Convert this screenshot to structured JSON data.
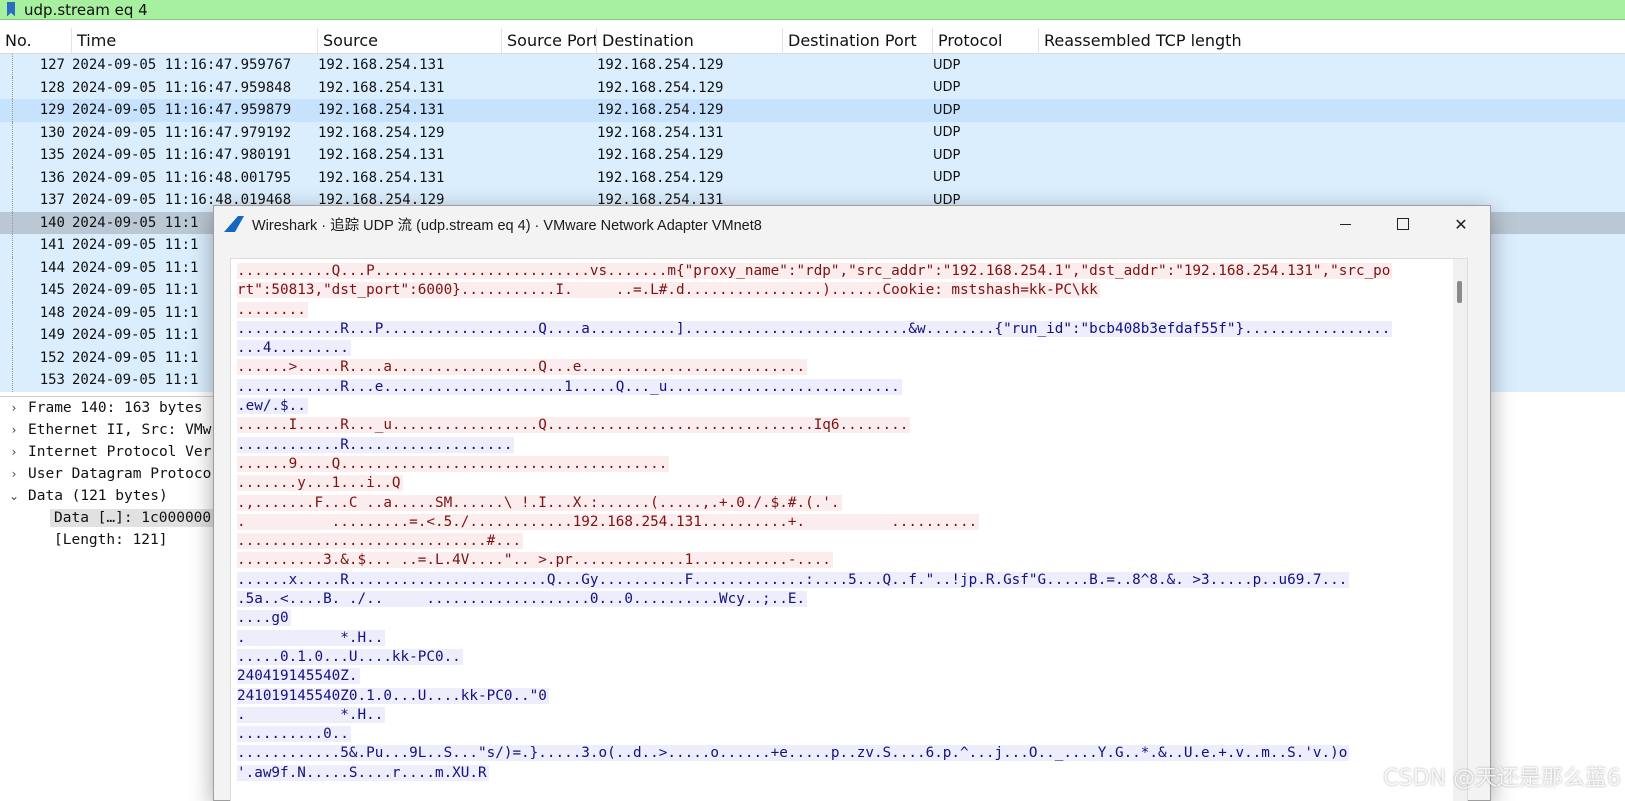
{
  "filter": {
    "text": "udp.stream eq 4"
  },
  "packet_list": {
    "columns": [
      "No.",
      "Time",
      "Source",
      "Source Port",
      "Destination",
      "Destination Port",
      "Protocol",
      "Reassembled TCP length"
    ],
    "rows": [
      {
        "no": "127",
        "time": "2024-09-05 11:16:47.959767",
        "src": "192.168.254.131",
        "sport": "",
        "dst": "192.168.254.129",
        "dport": "",
        "proto": "UDP",
        "len": ""
      },
      {
        "no": "128",
        "time": "2024-09-05 11:16:47.959848",
        "src": "192.168.254.131",
        "sport": "",
        "dst": "192.168.254.129",
        "dport": "",
        "proto": "UDP",
        "len": ""
      },
      {
        "no": "129",
        "time": "2024-09-05 11:16:47.959879",
        "src": "192.168.254.131",
        "sport": "",
        "dst": "192.168.254.129",
        "dport": "",
        "proto": "UDP",
        "len": ""
      },
      {
        "no": "130",
        "time": "2024-09-05 11:16:47.979192",
        "src": "192.168.254.129",
        "sport": "",
        "dst": "192.168.254.131",
        "dport": "",
        "proto": "UDP",
        "len": ""
      },
      {
        "no": "135",
        "time": "2024-09-05 11:16:47.980191",
        "src": "192.168.254.131",
        "sport": "",
        "dst": "192.168.254.129",
        "dport": "",
        "proto": "UDP",
        "len": ""
      },
      {
        "no": "136",
        "time": "2024-09-05 11:16:48.001795",
        "src": "192.168.254.131",
        "sport": "",
        "dst": "192.168.254.129",
        "dport": "",
        "proto": "UDP",
        "len": ""
      },
      {
        "no": "137",
        "time": "2024-09-05 11:16:48.019468",
        "src": "192.168.254.129",
        "sport": "",
        "dst": "192.168.254.131",
        "dport": "",
        "proto": "UDP",
        "len": ""
      },
      {
        "no": "140",
        "time": "2024-09-05 11:1",
        "src": "",
        "sport": "",
        "dst": "",
        "dport": "",
        "proto": "",
        "len": ""
      },
      {
        "no": "141",
        "time": "2024-09-05 11:1",
        "src": "",
        "sport": "",
        "dst": "",
        "dport": "",
        "proto": "",
        "len": ""
      },
      {
        "no": "144",
        "time": "2024-09-05 11:1",
        "src": "",
        "sport": "",
        "dst": "",
        "dport": "",
        "proto": "",
        "len": ""
      },
      {
        "no": "145",
        "time": "2024-09-05 11:1",
        "src": "",
        "sport": "",
        "dst": "",
        "dport": "",
        "proto": "",
        "len": ""
      },
      {
        "no": "148",
        "time": "2024-09-05 11:1",
        "src": "",
        "sport": "",
        "dst": "",
        "dport": "",
        "proto": "",
        "len": ""
      },
      {
        "no": "149",
        "time": "2024-09-05 11:1",
        "src": "",
        "sport": "",
        "dst": "",
        "dport": "",
        "proto": "",
        "len": ""
      },
      {
        "no": "152",
        "time": "2024-09-05 11:1",
        "src": "",
        "sport": "",
        "dst": "",
        "dport": "",
        "proto": "",
        "len": ""
      },
      {
        "no": "153",
        "time": "2024-09-05 11:1",
        "src": "",
        "sport": "",
        "dst": "",
        "dport": "",
        "proto": "",
        "len": ""
      }
    ]
  },
  "details": {
    "items": [
      {
        "arrow": "›",
        "text": "Frame 140: 163 bytes"
      },
      {
        "arrow": "›",
        "text": "Ethernet II, Src: VMw"
      },
      {
        "arrow": "›",
        "text": "Internet Protocol Ver"
      },
      {
        "arrow": "›",
        "text": "User Datagram Protoco"
      },
      {
        "arrow": "⌄",
        "text": "Data (121 bytes)"
      }
    ],
    "data_child": "Data […]: 1c000000",
    "length_child": "[Length: 121]"
  },
  "dialog": {
    "title": "Wireshark · 追踪 UDP 流 (udp.stream eq 4) · VMware Network Adapter VMnet8",
    "close_glyph": "✕",
    "stream_lines": [
      {
        "dir": "cli",
        "text": "...........Q...P.........................vs.......m{\"proxy_name\":\"rdp\",\"src_addr\":\"192.168.254.1\",\"dst_addr\":\"192.168.254.131\",\"src_po"
      },
      {
        "dir": "cli",
        "text": "rt\":50813,\"dst_port\":6000}...........I.     ..=.L#.d................)......Cookie: mstshash=kk-PC\\kk"
      },
      {
        "dir": "cli",
        "text": "........"
      },
      {
        "dir": "srv",
        "text": "............R...P..................Q....a..........]..........................&w........{\"run_id\":\"bcb408b3efdaf55f\"}................."
      },
      {
        "dir": "srv",
        "text": "...4........."
      },
      {
        "dir": "cli",
        "text": "......>.....R....a.................Q...e.........................."
      },
      {
        "dir": "srv",
        "text": "............R...e.....................1.....Q..._u..........................."
      },
      {
        "dir": "srv",
        "text": ".ew/.$.."
      },
      {
        "dir": "cli",
        "text": "......I.....R..._u.................Q...............................Iq6........"
      },
      {
        "dir": "srv",
        "text": "............R..................."
      },
      {
        "dir": "cli",
        "text": "......9....Q......................................"
      },
      {
        "dir": "cli",
        "text": ".......y...1...i..Q"
      },
      {
        "dir": "cli",
        "text": ".,.......F...C ..a.....SM......\\ !.I...X.:......(.....,.+.0./.$.#.(.'."
      },
      {
        "dir": "cli",
        "text": ".          .........=.<.5./............192.168.254.131..........+.          .........."
      },
      {
        "dir": "cli",
        "text": ".............................#..."
      },
      {
        "dir": "cli",
        "text": "..........3.&.$... ..=.L.4V....\".. >.pr.............1...........-...."
      },
      {
        "dir": "srv",
        "text": "......x.....R.......................Q...Gy..........F.............:....5...Q..f.\"..!jp.R.Gsf\"G.....B.=..8^8.&. >3.....p..u69.7..."
      },
      {
        "dir": "srv",
        "text": ".5a..<....B. ./..     ...................0...0..........Wcy..;..E."
      },
      {
        "dir": "srv",
        "text": "....g0"
      },
      {
        "dir": "srv",
        "text": ".           *.H.."
      },
      {
        "dir": "srv",
        "text": ".....0.1.0...U....kk-PC0.."
      },
      {
        "dir": "srv",
        "text": "240419145540Z."
      },
      {
        "dir": "srv",
        "text": "241019145540Z0.1.0...U....kk-PC0..\"0"
      },
      {
        "dir": "srv",
        "text": ".           *.H.."
      },
      {
        "dir": "srv",
        "text": "..........0.."
      },
      {
        "dir": "srv",
        "text": "............5&.Pu...9L..S...\"s/)=.}.....3.o(..d..>.....o......+e.....p..zv.S....6.p.^...j...O.._....Y.G..*.&..U.e.+.v..m..S.'v.)o"
      },
      {
        "dir": "srv",
        "text": "'.aw9f.N.....S....r....m.XU.R"
      }
    ]
  },
  "watermark": "CSDN @天还是那么蓝6"
}
